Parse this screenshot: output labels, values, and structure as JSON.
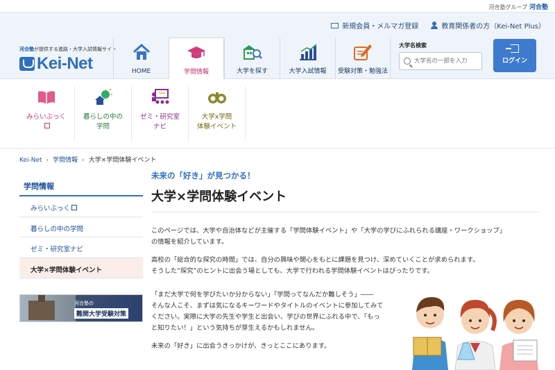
{
  "topbar": {
    "group_label": "河合塾グループ",
    "brand": "河合塾"
  },
  "header": {
    "links": [
      {
        "label": "新規会員・メルマガ登録"
      },
      {
        "label": "教育関係者の方（Kei-Net Plus）"
      }
    ],
    "logo_tag_brand": "河合塾",
    "logo_tag_rest": "が提供する進路・大学入試情報サイト",
    "logo_word": "Kei-Net",
    "nav": [
      {
        "label": "HOME",
        "icon": "home-icon",
        "color": "#3a73c4"
      },
      {
        "label": "学問情報",
        "icon": "graduation-cap-icon",
        "color": "#d13a7a",
        "active": true
      },
      {
        "label": "大学を探す",
        "icon": "campus-search-icon",
        "color": "#2e9a56"
      },
      {
        "label": "大学入試情報",
        "icon": "bar-chart-icon",
        "color": "#2b4f9a"
      },
      {
        "label": "受験対策・勉強法",
        "icon": "pencil-icon",
        "color": "#e06a1a"
      }
    ],
    "search": {
      "title": "大学名検索",
      "placeholder": "大学名の一部を入力"
    },
    "login_label": "ログイン"
  },
  "subnav": [
    {
      "label": "みらいぶっく",
      "icon": "open-book-icon",
      "color": "#c7346d",
      "external": true
    },
    {
      "label": "暮らしの中の\n学問",
      "icon": "lightbulb-house-icon",
      "color": "#2f7c3b"
    },
    {
      "label": "ゼミ・研究室\nナビ",
      "icon": "seminar-icon",
      "color": "#8a2c8f"
    },
    {
      "label": "大学x学問\n体験イベント",
      "icon": "binoculars-icon",
      "color": "#6c6b1a"
    }
  ],
  "breadcrumb": [
    "Kei-Net",
    "学問情報",
    "大学×学問体験イベント"
  ],
  "side": {
    "heading": "学問情報",
    "items": [
      {
        "label": "みらいぶっく",
        "external": true
      },
      {
        "label": "暮らしの中の学問"
      },
      {
        "label": "ゼミ・研究室ナビ"
      },
      {
        "label": "大学×学問体験イベント",
        "current": true
      }
    ],
    "banner": {
      "small": "河合塾の",
      "large": "難関大学受験対策"
    }
  },
  "main": {
    "catch": "未来の「好き」が見つかる！",
    "title": "大学×学問体験イベント",
    "paragraphs": [
      [
        "このページでは、大学や自治体などが主催する「学問体験イベント」や「大学の学びにふれられる講座・ワークショップ」",
        "の情報を紹介しています。"
      ],
      [
        "高校の「総合的な探究の時間」では、自分の興味や関心をもとに課題を見つけ、深めていくことが求められます。",
        "そうした“探究”のヒントに出会う場としても、大学で行われる学問体験イベントはぴったりです。"
      ],
      [
        "「まだ大学で何を学びたいか分からない」「学問ってなんだか難しそう」――",
        "そんな人こそ、まずは気になるキーワードやタイトルのイベントに参加してみて",
        "ください。実際に大学の先生や学生と出会い、学びの世界にふれる中で、「もっ",
        "と知りたい！」という気持ちが芽生えるかもしれません。"
      ],
      [
        "未来の「好き」に出会うきっかけが、きっとここにあります。"
      ]
    ]
  }
}
